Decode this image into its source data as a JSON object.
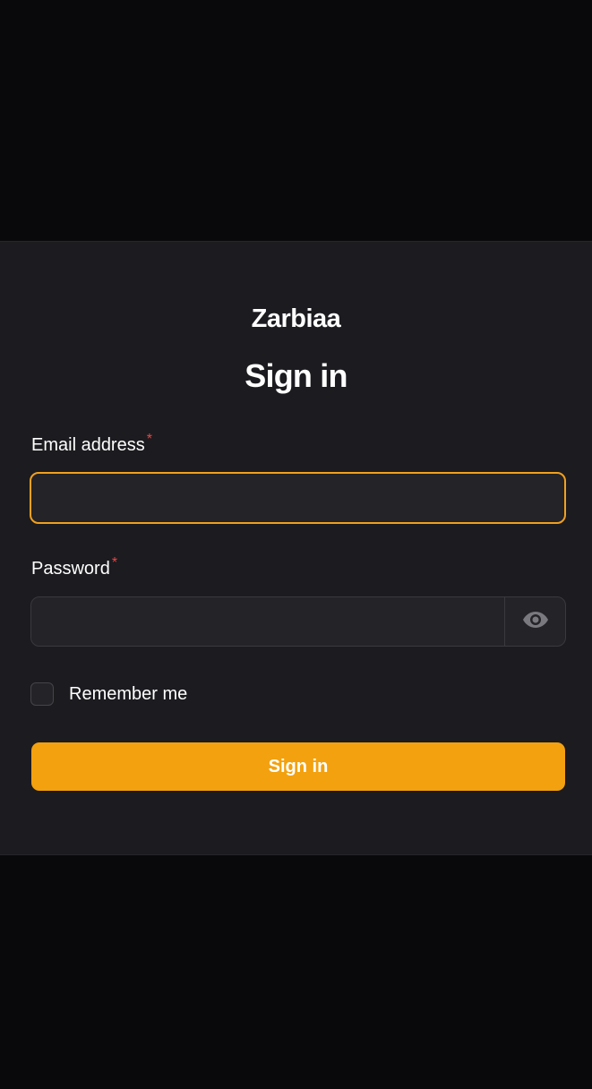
{
  "brand": {
    "name": "Zarbiaa"
  },
  "form": {
    "heading": "Sign in",
    "email": {
      "label": "Email address",
      "required_mark": "*",
      "value": "",
      "placeholder": ""
    },
    "password": {
      "label": "Password",
      "required_mark": "*",
      "value": "",
      "placeholder": "",
      "toggle_icon": "eye-icon"
    },
    "remember": {
      "label": "Remember me",
      "checked": false
    },
    "submit_label": "Sign in"
  },
  "colors": {
    "accent": "#f3a10f",
    "focus_border": "#f0a020",
    "required": "#ef4444",
    "page_background": "#09090b",
    "card_background": "#1c1b1f"
  }
}
